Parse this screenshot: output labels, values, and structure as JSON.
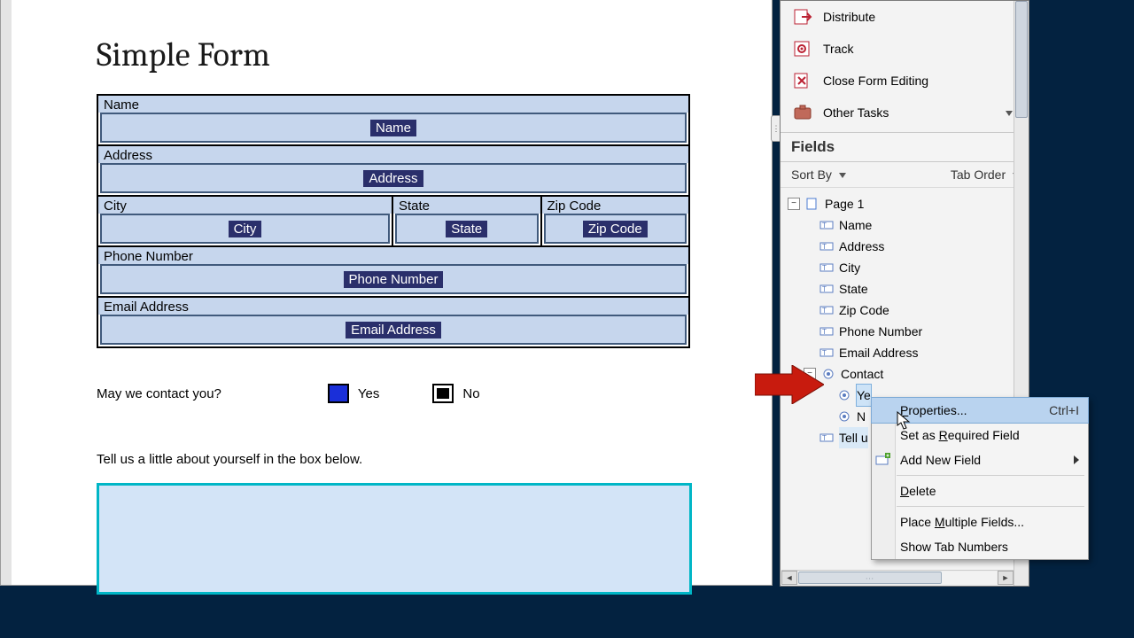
{
  "form": {
    "title": "Simple Form",
    "labels": {
      "name": "Name",
      "address": "Address",
      "city": "City",
      "state": "State",
      "zip": "Zip Code",
      "phone": "Phone Number",
      "email": "Email Address"
    },
    "fields": {
      "name": "Name",
      "address": "Address",
      "city": "City",
      "state": "State",
      "zip": "Zip Code",
      "phone": "Phone Number",
      "email": "Email Address"
    },
    "contactQuestion": "May we contact you?",
    "yes": "Yes",
    "no": "No",
    "aboutPrompt": "Tell us a little about yourself in the box below."
  },
  "tools": {
    "distribute": "Distribute",
    "track": "Track",
    "closeFormEditing": "Close Form Editing",
    "otherTasks": "Other Tasks"
  },
  "fieldsHeader": "Fields",
  "sortBy": "Sort By",
  "tabOrder": "Tab Order",
  "tree": {
    "page": "Page 1",
    "items": [
      "Name",
      "Address",
      "City",
      "State",
      "Zip Code",
      "Phone Number",
      "Email Address"
    ],
    "contact": "Contact",
    "yes": "Ye",
    "no": "N",
    "tellus": "Tell u"
  },
  "ctx": {
    "properties": "Properties...",
    "propertiesShortcut": "Ctrl+I",
    "setRequired": "Set as Required Field",
    "addNew": "Add New Field",
    "delete": "Delete",
    "placeMultiple": "Place Multiple Fields...",
    "showTab": "Show Tab Numbers"
  }
}
